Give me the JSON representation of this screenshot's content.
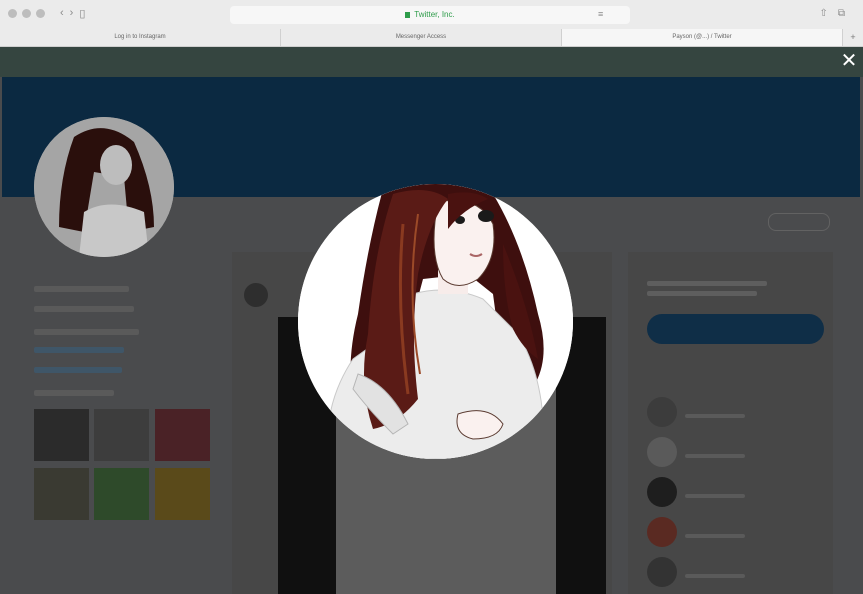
{
  "browser": {
    "address": "Twitter, Inc.",
    "tabs": [
      {
        "label": "Log in to Instagram"
      },
      {
        "label": "Messenger Access"
      },
      {
        "label": "Payson (@...) / Twitter"
      }
    ]
  },
  "modal": {
    "close_symbol": "✕"
  },
  "icons": {
    "close": "close-icon",
    "lock": "lock-icon",
    "back": "chevron-left-icon",
    "forward": "chevron-right-icon"
  },
  "colors": {
    "banner": "#0b2941",
    "overlay_bg": "#4a4b4d",
    "hair": "#4a1a14"
  }
}
